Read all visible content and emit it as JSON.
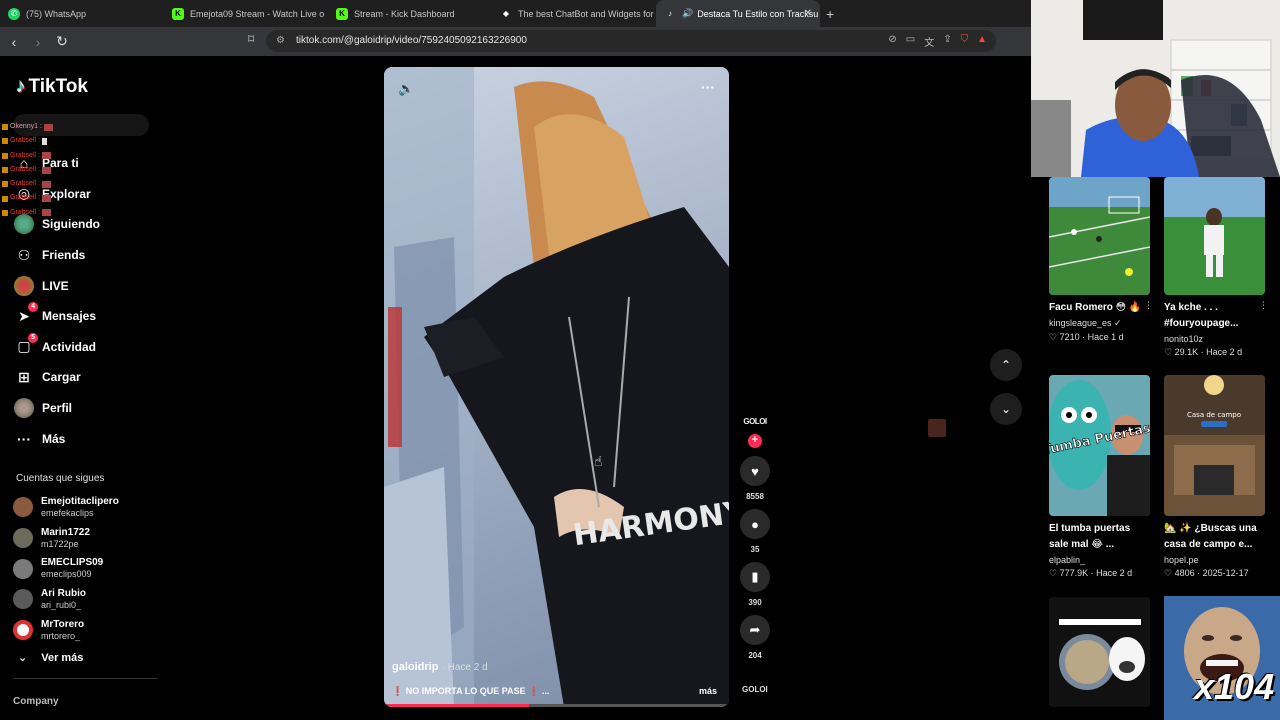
{
  "browser": {
    "tabs": [
      {
        "title": "(75) WhatsApp",
        "icon": "whatsapp-icon"
      },
      {
        "title": "Emejota09 Stream - Watch Live o",
        "icon": "kick-icon"
      },
      {
        "title": "Stream - Kick Dashboard",
        "icon": "kick-icon"
      },
      {
        "title": "The best ChatBot and Widgets for Ki",
        "icon": "botrix-icon"
      },
      {
        "title": "Destaca Tu Estilo con Tracksu",
        "icon": "tiktok-icon",
        "active": true
      }
    ],
    "url": "tiktok.com/@galoidrip/video/7592405092163226900"
  },
  "sidebar": {
    "logo": "TikTok",
    "nav": [
      {
        "label": "Para ti",
        "icon": "home-icon"
      },
      {
        "label": "Explorar",
        "icon": "compass-icon"
      },
      {
        "label": "Siguiendo",
        "icon": "following-icon"
      },
      {
        "label": "Friends",
        "icon": "friends-icon"
      },
      {
        "label": "LIVE",
        "icon": "live-icon"
      },
      {
        "label": "Mensajes",
        "icon": "messages-icon",
        "badge": "4"
      },
      {
        "label": "Actividad",
        "icon": "activity-icon",
        "badge": "5"
      },
      {
        "label": "Cargar",
        "icon": "upload-icon"
      },
      {
        "label": "Perfil",
        "icon": "profile-icon"
      },
      {
        "label": "Más",
        "icon": "more-icon"
      }
    ],
    "following_title": "Cuentas que sigues",
    "following": [
      {
        "name": "Emejotitaclipero",
        "handle": "emefekaclips",
        "color": "#8a5a3c"
      },
      {
        "name": "Marin1722",
        "handle": "m1722pe",
        "color": "#6b6b5a"
      },
      {
        "name": "EMECLIPS09",
        "handle": "emeclips009",
        "color": "#7a7a7a"
      },
      {
        "name": "Ari Rubio",
        "handle": "ari_rubi0_",
        "color": "#5a5a5a"
      },
      {
        "name": "MrTorero",
        "handle": "mrtorero_",
        "color": "#d33"
      }
    ],
    "see_more": "Ver más",
    "company": "Company"
  },
  "chat_overlay": [
    {
      "user": "Okenny1 :"
    },
    {
      "user": "Grabsell :"
    },
    {
      "user": "Grabsell :"
    },
    {
      "user": "Grabsell :"
    },
    {
      "user": "Grabsell :"
    },
    {
      "user": "Grabsell :"
    },
    {
      "user": "Grabsell :"
    }
  ],
  "video": {
    "author": "galoidrip",
    "time": "· Hace 2 d",
    "caption": "NO IMPORTA LO QUE PASE",
    "caption_suffix": "...",
    "more": "más",
    "progress": 0.42,
    "shirt_text": "HARMONY"
  },
  "actions": {
    "avatar_text": "GOLOI",
    "likes": "8558",
    "comments": "35",
    "saves": "390",
    "shares": "204",
    "next_avatar_text": "GOLOI"
  },
  "recommendations": [
    {
      "title": "Facu Romero 😳 🔥",
      "author": "kingsleague_es ✓",
      "likes": "♡ 7210",
      "time": "Hace 1 d",
      "theme": "football-field"
    },
    {
      "title": "Ya kche . . . #fouryoupage...",
      "author": "nonito10z",
      "likes": "♡ 29.1K",
      "time": "Hace 2 d",
      "theme": "football-player"
    },
    {
      "title": "El tumba puertas sale mal 😂 ...",
      "author": "elpablin_",
      "likes": "♡ 777.9K",
      "time": "Hace 2 d",
      "theme": "mascot",
      "overlay": "Tumba Puertas"
    },
    {
      "title": "🏡 ✨ ¿Buscas una casa de campo e...",
      "author": "hopel.pe",
      "likes": "♡ 4806",
      "time": "2025-12-17",
      "theme": "house",
      "overlay": "Casa de campo"
    },
    {
      "title": "",
      "author": "",
      "likes": "",
      "time": "",
      "theme": "meme"
    },
    {
      "title": "",
      "author": "",
      "likes": "",
      "time": "",
      "theme": "laugh"
    }
  ],
  "overlay_text": "x104"
}
